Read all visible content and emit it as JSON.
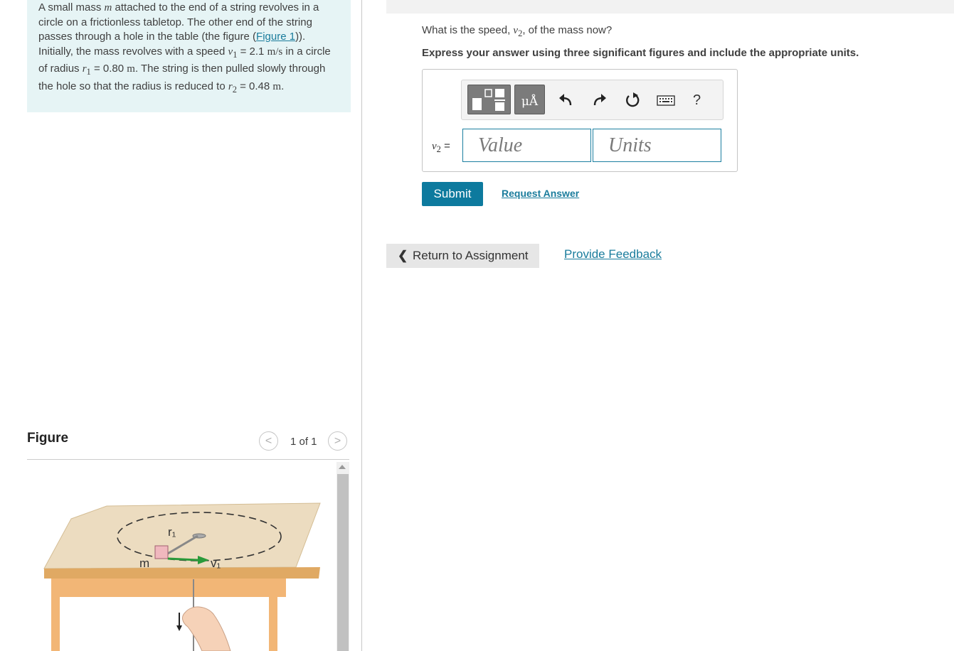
{
  "problem": {
    "text_1": "A small mass ",
    "var_m": "m",
    "text_2": " attached to the end of a string revolves in a circle on a frictionless tabletop. The other end of the string passes through a hole in the table (the figure (",
    "figure_link": "Figure 1",
    "text_3": ")). Initially, the mass revolves with a speed ",
    "var_v1": "v",
    "sub_1": "1",
    "eq_1": " = 2.1 ",
    "unit_ms": "m/s",
    "text_4": " in a circle of radius ",
    "var_r1": "r",
    "eq_2": " = 0.80 ",
    "unit_m1": "m",
    "text_5": ". The string is then pulled slowly through the hole so that the radius is reduced to ",
    "var_r2": "r",
    "sub_2": "2",
    "eq_3": " = 0.48 ",
    "unit_m2": "m",
    "text_6": "."
  },
  "figure": {
    "title": "Figure",
    "page_indicator": "1 of 1",
    "prev_symbol": "<",
    "next_symbol": ">",
    "label_r1": "r₁",
    "label_m": "m",
    "label_v1": "v₁"
  },
  "question": {
    "text_prefix": "What is the speed, ",
    "var": "v",
    "sub": "2",
    "text_suffix": ", of the mass now?"
  },
  "instruction": "Express your answer using three significant figures and include the appropriate units.",
  "toolbar": {
    "units_label": "μÅ",
    "help_label": "?",
    "icons": [
      "templates-icon",
      "units-icon",
      "undo-icon",
      "redo-icon",
      "reset-icon",
      "keyboard-icon",
      "help-icon"
    ]
  },
  "answer": {
    "var": "v",
    "sub": "2",
    "equals": " =",
    "value_placeholder": "Value",
    "units_placeholder": "Units"
  },
  "buttons": {
    "submit": "Submit",
    "request_answer": "Request Answer",
    "return_label": "Return to Assignment",
    "feedback": "Provide Feedback"
  },
  "colors": {
    "accent": "#0d7a9e",
    "link": "#1a7c9c",
    "problem_bg": "#e6f4f5"
  }
}
